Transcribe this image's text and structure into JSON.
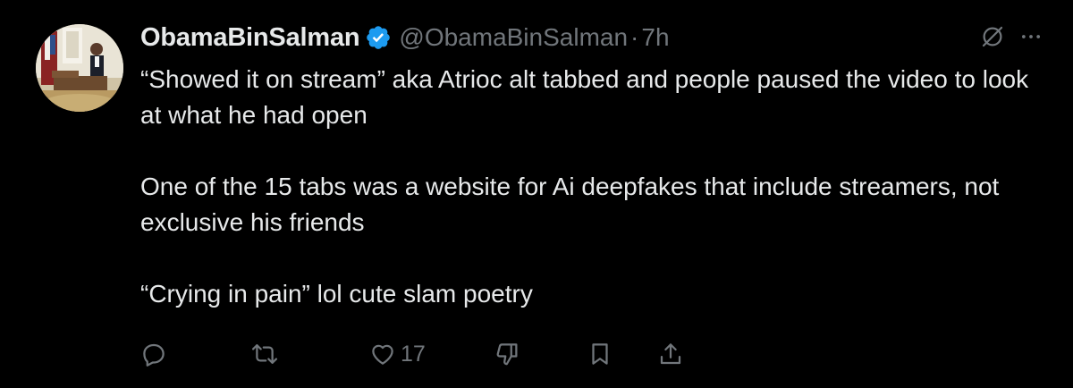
{
  "author": {
    "display_name": "ObamaBinSalman",
    "handle": "@ObamaBinSalman",
    "separator": "·",
    "time": "7h",
    "verified": true
  },
  "tweet": {
    "paragraphs": [
      "“Showed it on stream” aka Atrioc alt tabbed and people paused the video to look at what he had open",
      "One of the 15 tabs was a website for Ai deepfakes that include streamers, not exclusive his friends",
      "“Crying in pain” lol cute slam poetry"
    ]
  },
  "top_actions": {
    "icons": [
      "grok-icon",
      "more-icon"
    ]
  },
  "action_bar": {
    "reply_icon": "reply-icon",
    "retweet_icon": "retweet-icon",
    "like_icon": "heart-icon",
    "like_count": "17",
    "dislike_icon": "thumbs-down-icon",
    "bookmark_icon": "bookmark-icon",
    "share_icon": "share-icon"
  },
  "colors": {
    "background": "#000000",
    "primary_text": "#e7e9ea",
    "secondary_text": "#71767b",
    "verified_blue": "#1d9bf0"
  }
}
